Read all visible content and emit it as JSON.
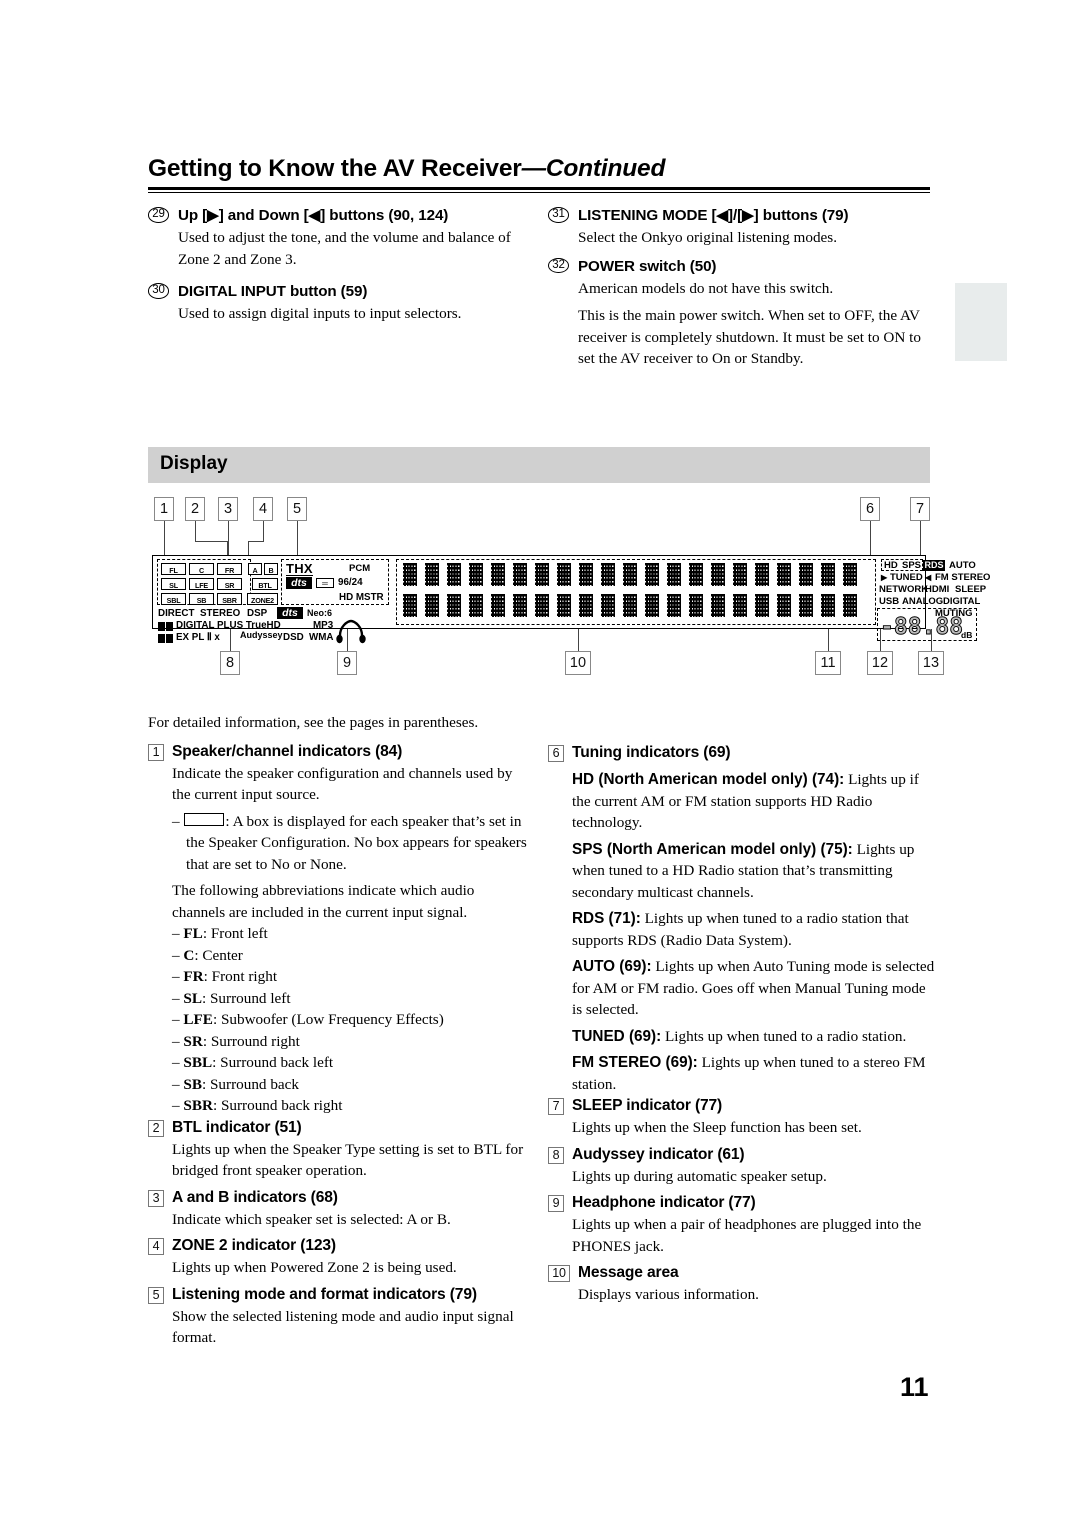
{
  "header": {
    "title_main": "Getting to Know the AV Receiver",
    "title_cont": "—Continued"
  },
  "page_number": "11",
  "top_items": {
    "left": [
      {
        "num": "29",
        "heading": "Up [▶] and Down [◀] buttons (90, 124)",
        "body": "Used to adjust the tone, and the volume and balance of Zone 2 and Zone 3."
      },
      {
        "num": "30",
        "heading": "DIGITAL INPUT button (59)",
        "body": "Used to assign digital inputs to input selectors."
      }
    ],
    "right": [
      {
        "num": "31",
        "heading": "LISTENING MODE [◀]/[▶] buttons (79)",
        "body": "Select the Onkyo original listening modes."
      },
      {
        "num": "32",
        "heading": "POWER switch (50)",
        "body": "American models do not have this switch.",
        "body2": "This is the main power switch. When set to OFF, the AV receiver is completely shutdown. It must be set to ON to set the AV receiver to On or Standby."
      }
    ]
  },
  "section": {
    "display_title": "Display"
  },
  "diagram": {
    "callouts_top": [
      "1",
      "2",
      "3",
      "4",
      "5",
      "6",
      "7"
    ],
    "callouts_bottom": [
      "8",
      "9",
      "10",
      "11",
      "12",
      "13"
    ],
    "speaker_cells": [
      "FL",
      "C",
      "FR",
      "SL",
      "LFE",
      "SR",
      "SBL",
      "SB",
      "SBR"
    ],
    "ab_cells": [
      "A",
      "B"
    ],
    "btl_label": "BTL",
    "zone2_label": "ZONE2",
    "format_labels": {
      "thx": "THX",
      "pcm": "PCM",
      "dts": "dts",
      "bitrate": "96/24",
      "hd_mstr": "HD MSTR",
      "neo6": "Neo:6",
      "direct": "DIRECT",
      "stereo": "STEREO",
      "dsp": "DSP",
      "dolby_digital_plus_truehd": "DIGITAL PLUS TrueHD",
      "dolby_ex_pl2x": "EX PL Ⅱ x",
      "audyssey": "Audyssey",
      "mp3": "MP3",
      "dsd": "DSD",
      "wma": "WMA"
    },
    "tuning_labels": {
      "hd": "HD",
      "sps": "SPS",
      "rds": "RDS",
      "auto": "AUTO",
      "tuned": "TUNED",
      "fm_stereo": "FM STEREO",
      "network": "NETWORK",
      "hdmi": "HDMI",
      "sleep": "SLEEP",
      "usb": "USB",
      "analog": "ANALOG",
      "digital": "DIGITAL"
    },
    "volume": {
      "muting": "MUTING",
      "value": "-88.88",
      "unit": "dB"
    }
  },
  "details": {
    "intro": "For detailed information, see the pages in parentheses.",
    "left": [
      {
        "num": "1",
        "heading": "Speaker/channel indicators (84)",
        "body": "Indicate the speaker configuration and channels used by the current input source.",
        "box_note_suffix": ": A box is displayed for each speaker that’s set in the Speaker Configuration. No box appears for speakers that are set to No or None.",
        "body2": "The following abbreviations indicate which audio channels are included in the current input signal.",
        "abbrevs": [
          {
            "abbr": "FL",
            "desc": ": Front left"
          },
          {
            "abbr": "C",
            "desc": ": Center"
          },
          {
            "abbr": "FR",
            "desc": ": Front right"
          },
          {
            "abbr": "SL",
            "desc": ": Surround left"
          },
          {
            "abbr": "LFE",
            "desc": ": Subwoofer (Low Frequency Effects)"
          },
          {
            "abbr": "SR",
            "desc": ": Surround right"
          },
          {
            "abbr": "SBL",
            "desc": ": Surround back left"
          },
          {
            "abbr": "SB",
            "desc": ": Surround back"
          },
          {
            "abbr": "SBR",
            "desc": ": Surround back right"
          }
        ]
      },
      {
        "num": "2",
        "heading": "BTL indicator (51)",
        "body": "Lights up when the Speaker Type setting is set to BTL for bridged front speaker operation."
      },
      {
        "num": "3",
        "heading": "A and B indicators (68)",
        "body": "Indicate which speaker set is selected: A or B."
      },
      {
        "num": "4",
        "heading": "ZONE 2 indicator (123)",
        "body": "Lights up when Powered Zone 2 is being used."
      },
      {
        "num": "5",
        "heading": "Listening mode and format indicators (79)",
        "body": "Show the selected listening mode and audio input signal format."
      }
    ],
    "right": [
      {
        "num": "6",
        "heading": "Tuning indicators (69)",
        "subs": [
          {
            "label": "HD (North American model only) (74):",
            "text": " Lights up if the current AM or FM station supports HD Radio technology."
          },
          {
            "label": "SPS (North American model only) (75):",
            "text": " Lights up when tuned to a HD Radio station that’s transmitting secondary multicast channels."
          },
          {
            "label": "RDS (71):",
            "text": " Lights up when tuned to a radio station that supports RDS (Radio Data System)."
          },
          {
            "label": "AUTO (69):",
            "text": " Lights up when Auto Tuning mode is selected for AM or FM radio. Goes off when Manual Tuning mode is selected."
          },
          {
            "label": "TUNED (69):",
            "text": " Lights up when tuned to a radio station."
          },
          {
            "label": "FM STEREO (69):",
            "text": " Lights up when tuned to a stereo FM station."
          }
        ]
      },
      {
        "num": "7",
        "heading": "SLEEP indicator (77)",
        "body": "Lights up when the Sleep function has been set."
      },
      {
        "num": "8",
        "heading": "Audyssey indicator (61)",
        "body": "Lights up during automatic speaker setup."
      },
      {
        "num": "9",
        "heading": "Headphone indicator (77)",
        "body": "Lights up when a pair of headphones are plugged into the PHONES jack."
      },
      {
        "num": "10",
        "heading": "Message area",
        "body": "Displays various information."
      }
    ]
  }
}
